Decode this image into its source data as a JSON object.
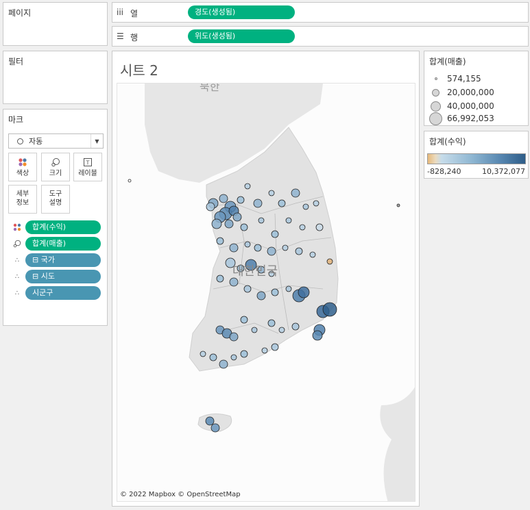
{
  "pages_panel": {
    "title": "페이지"
  },
  "filters_panel": {
    "title": "필터"
  },
  "marks_panel": {
    "title": "마크",
    "mark_type": "자동",
    "buttons": [
      {
        "label": "색상",
        "icon": "color-dots-icon"
      },
      {
        "label": "크기",
        "icon": "size-icon"
      },
      {
        "label": "레이블",
        "icon": "label-icon"
      },
      {
        "label": "세부\n정보",
        "line1": "세부",
        "line2": "정보",
        "icon": ""
      },
      {
        "label": "도구\n설명",
        "line1": "도구",
        "line2": "설명",
        "icon": ""
      }
    ],
    "pills": [
      {
        "label": "합계(수익)",
        "icon": "color-dots-icon",
        "color": "#00b180"
      },
      {
        "label": "합계(매출)",
        "icon": "size-icon",
        "color": "#00b180"
      },
      {
        "label": "⊟ 국가",
        "icon": "detail-icon",
        "color": "#4996b2"
      },
      {
        "label": "⊟ 시도",
        "icon": "detail-icon",
        "color": "#4996b2"
      },
      {
        "label": "시군구",
        "icon": "detail-icon",
        "color": "#4996b2"
      }
    ]
  },
  "columns_shelf": {
    "icon": "iii",
    "label": "열",
    "pill": "경도(생성됨)"
  },
  "rows_shelf": {
    "icon": "☰",
    "label": "행",
    "pill": "위도(생성됨)"
  },
  "sheet": {
    "title": "시트 2",
    "map_label": "대한민국",
    "top_label": "북한",
    "attribution": "© 2022 Mapbox © OpenStreetMap"
  },
  "size_legend": {
    "title": "합계(매출)",
    "entries": [
      "574,155",
      "20,000,000",
      "40,000,000",
      "66,992,053"
    ]
  },
  "color_legend": {
    "title": "합계(수익)",
    "min": "-828,240",
    "max": "10,372,077"
  },
  "colors": {
    "accent_green": "#00b180",
    "pill_blue": "#4996b2"
  }
}
